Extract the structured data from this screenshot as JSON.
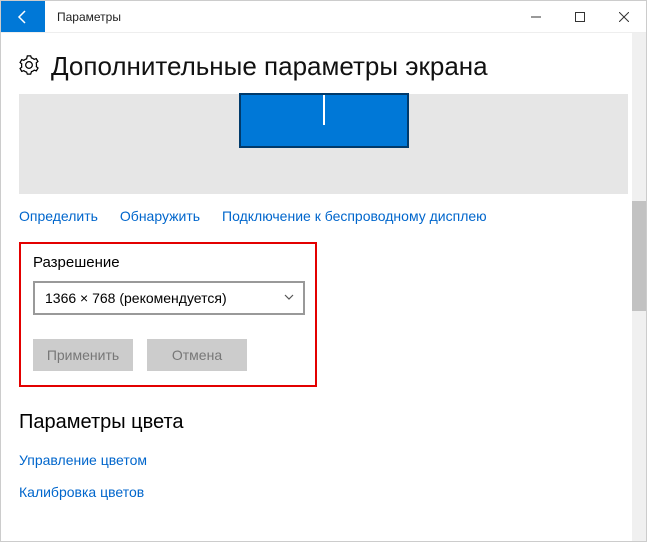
{
  "window": {
    "title": "Параметры"
  },
  "page": {
    "heading": "Дополнительные параметры экрана"
  },
  "links": {
    "identify": "Определить",
    "detect": "Обнаружить",
    "wireless": "Подключение к беспроводному дисплею"
  },
  "resolution": {
    "label": "Разрешение",
    "selected": "1366 × 768 (рекомендуется)",
    "apply": "Применить",
    "cancel": "Отмена"
  },
  "color": {
    "heading": "Параметры цвета",
    "manage": "Управление цветом",
    "calibrate": "Калибровка цветов"
  }
}
